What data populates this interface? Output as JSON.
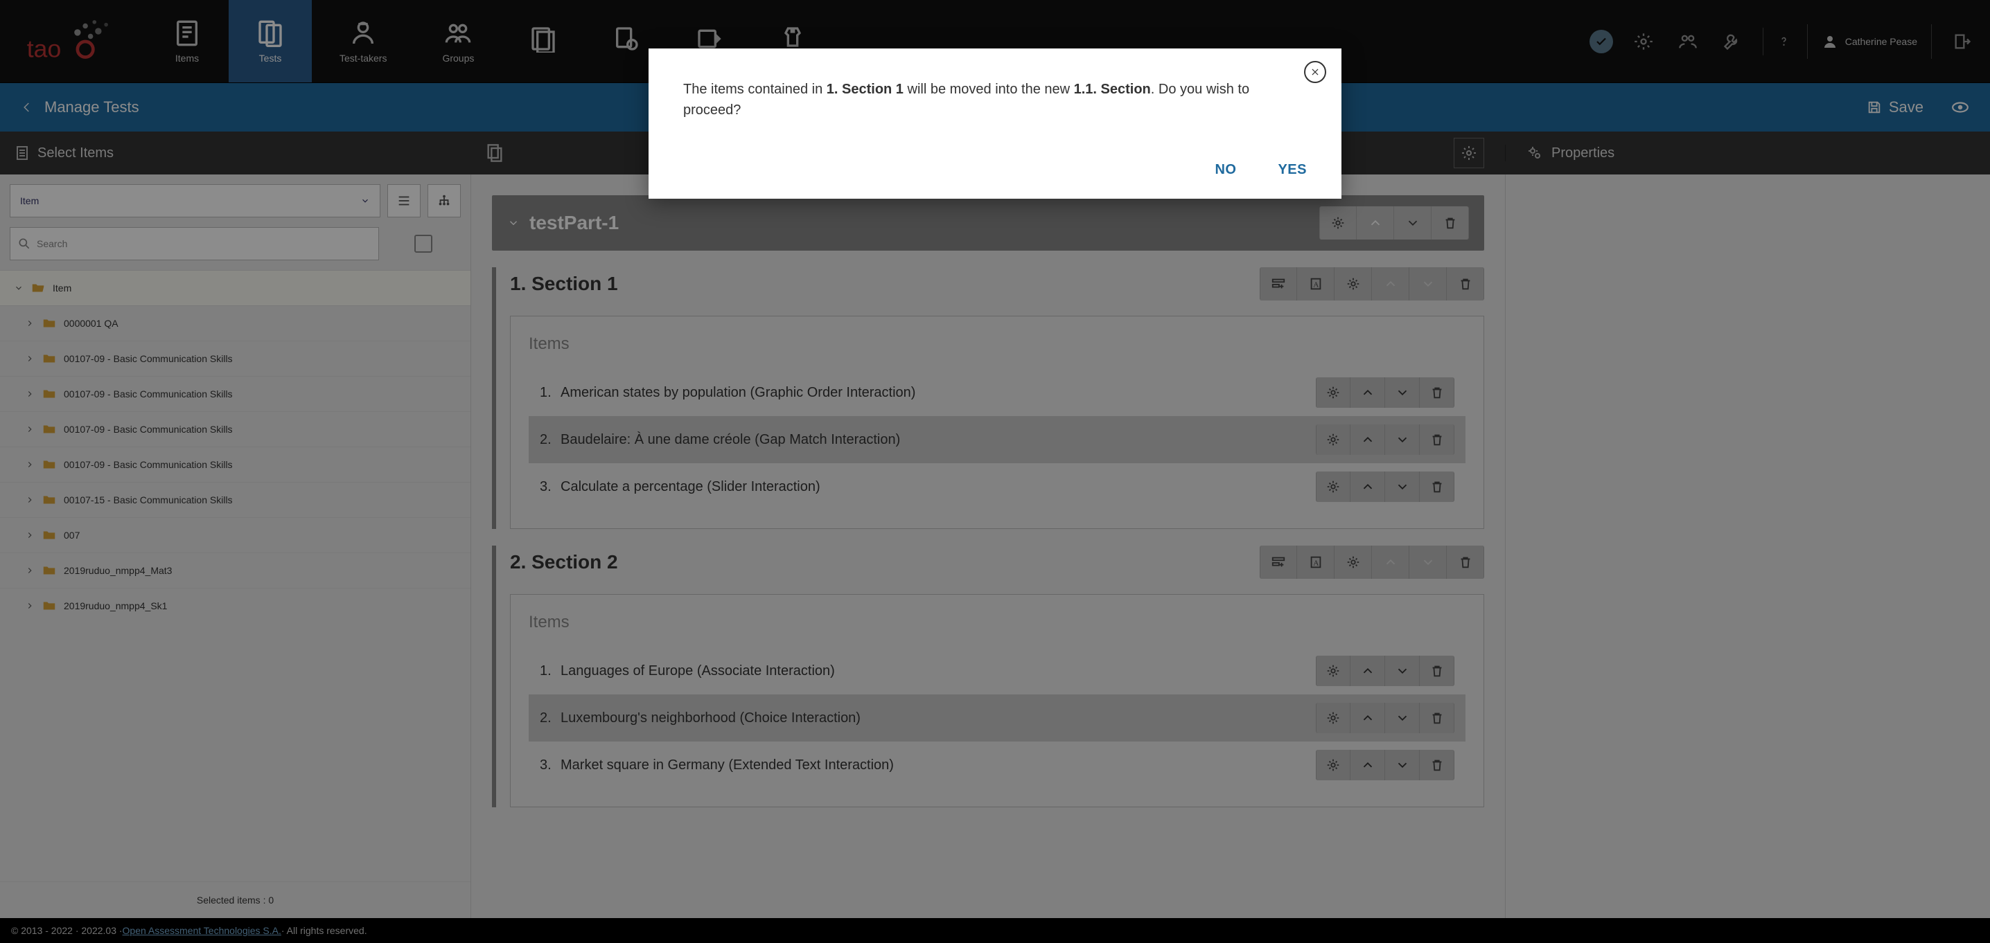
{
  "nav": {
    "tabs": [
      "Items",
      "Tests",
      "Test-takers",
      "Groups"
    ],
    "active": 1,
    "username": "Catherine Pease"
  },
  "subbar": {
    "title": "Manage Tests",
    "save": "Save"
  },
  "thirdbar": {
    "left": "Select Items",
    "right": "Properties"
  },
  "sidebar": {
    "selector_label": "Item",
    "search_placeholder": "Search",
    "root": "Item",
    "folders": [
      "0000001 QA",
      "00107-09 - Basic Communication Skills",
      "00107-09 - Basic Communication Skills",
      "00107-09 - Basic Communication Skills",
      "00107-09 - Basic Communication Skills",
      "00107-15 - Basic Communication Skills",
      "007",
      "2019ruduo_nmpp4_Mat3",
      "2019ruduo_nmpp4_Sk1"
    ],
    "selected_label": "Selected items : 0"
  },
  "content": {
    "part_title": "testPart-1",
    "sections": [
      {
        "title": "1. Section 1",
        "items_label": "Items",
        "items": [
          {
            "n": "1.",
            "name": "American states by population (Graphic Order Interaction)",
            "up_disabled": true
          },
          {
            "n": "2.",
            "name": "Baudelaire: À une dame créole (Gap Match Interaction)",
            "alt": true
          },
          {
            "n": "3.",
            "name": "Calculate a percentage (Slider Interaction)",
            "down_disabled": true
          }
        ]
      },
      {
        "title": "2. Section 2",
        "items_label": "Items",
        "items": [
          {
            "n": "1.",
            "name": "Languages of Europe (Associate Interaction)",
            "up_disabled": true
          },
          {
            "n": "2.",
            "name": "Luxembourg's neighborhood (Choice Interaction)",
            "alt": true
          },
          {
            "n": "3.",
            "name": "Market square in Germany (Extended Text Interaction)",
            "down_disabled": true
          }
        ]
      }
    ]
  },
  "modal": {
    "pre": "The items contained in ",
    "b1": "1. Section 1",
    "mid": " will be moved into the new ",
    "b2": "1.1. Section",
    "post": ". Do you wish to proceed?",
    "no": "NO",
    "yes": "YES"
  },
  "footer": {
    "copy": "© 2013 - 2022 · 2022.03 · ",
    "link": "Open Assessment Technologies S.A.",
    "rest": " · All rights reserved."
  }
}
